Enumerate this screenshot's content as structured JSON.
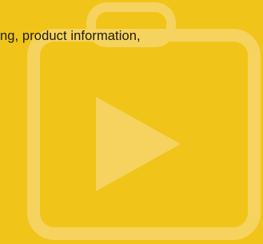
{
  "colors": {
    "background": "#F0C419",
    "icon_tint": "#F5D35E",
    "text": "#1F1B0C"
  },
  "decoration": {
    "icon": "play-folder-icon"
  },
  "content": {
    "text": "ng, product information,"
  }
}
